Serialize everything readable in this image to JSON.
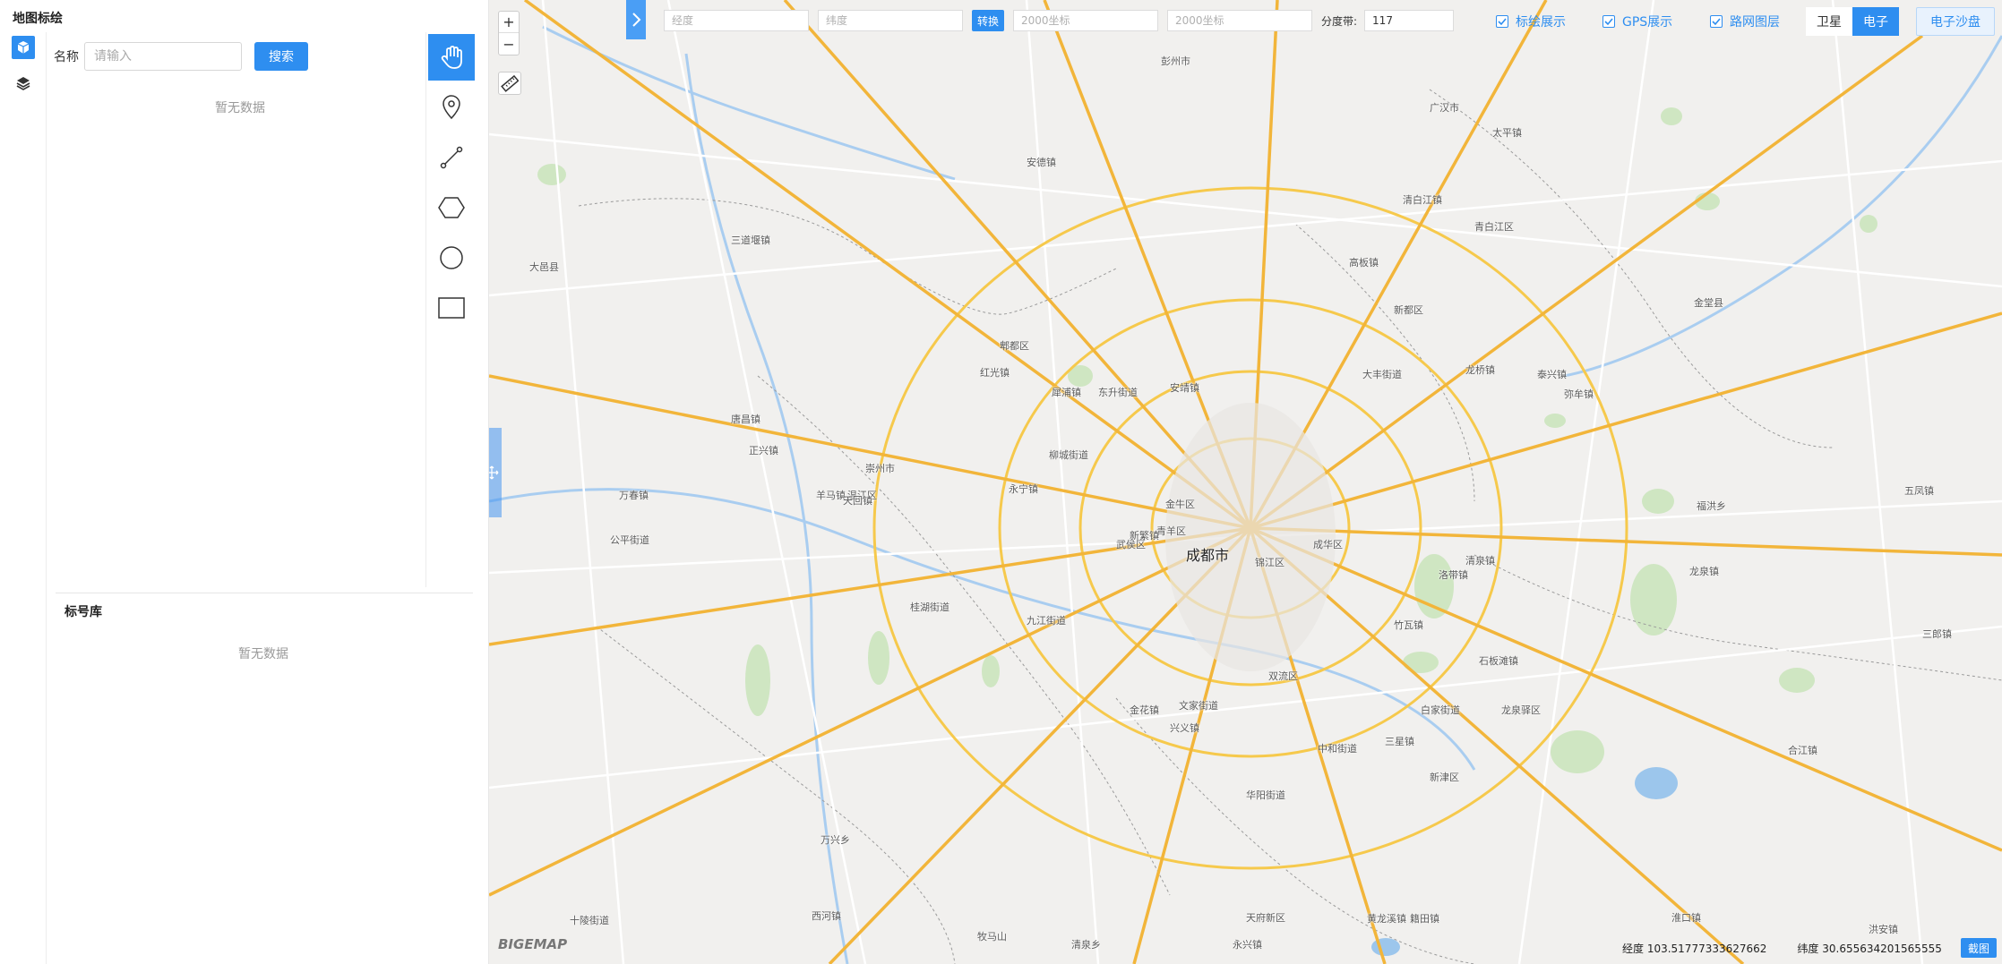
{
  "panel": {
    "title": "地图标绘",
    "search_label": "名称",
    "search_placeholder": "请输入",
    "search_button": "搜索",
    "empty_drawings": "暂无数据",
    "symbol_library_title": "标号库",
    "empty_symbols": "暂无数据"
  },
  "rail_icons": [
    "cube-icon",
    "layers-icon"
  ],
  "tools": [
    "hand-icon",
    "marker-icon",
    "polyline-icon",
    "polygon-icon",
    "circle-icon",
    "rectangle-icon"
  ],
  "toolbar": {
    "longitude_placeholder": "经度",
    "latitude_placeholder": "纬度",
    "convert_label": "转换",
    "x2000_placeholder": "2000坐标",
    "y2000_placeholder": "2000坐标",
    "zone_label": "分度带:",
    "zone_value": "117"
  },
  "layers": {
    "marker_display": "标绘展示",
    "gps_display": "GPS展示",
    "road_layer": "路网图层"
  },
  "basemap": {
    "satellite": "卫星",
    "electronic": "电子",
    "selected": "电子",
    "sandbox": "电子沙盘"
  },
  "zoom": {
    "in": "+",
    "out": "−"
  },
  "map": {
    "city": "成都市",
    "logo": "BIGEMAP",
    "longitude_readout": "经度 103.51777333627662",
    "latitude_readout": "纬度 30.655634201565555",
    "screenshot_button": "截图",
    "place_names": [
      "新都区",
      "郫都区",
      "温江区",
      "双流区",
      "龙泉驿区",
      "青白江区",
      "金牛区",
      "武侯区",
      "锦江区",
      "成华区",
      "青羊区",
      "彭州市",
      "广汉市",
      "崇州市",
      "大邑县",
      "新津区",
      "金堂县",
      "天府新区",
      "华阳街道",
      "红光镇",
      "犀浦镇",
      "安德镇",
      "唐昌镇",
      "三道堰镇",
      "竹瓦镇",
      "三星镇",
      "清泉镇",
      "石板滩镇",
      "洛带镇",
      "龙泉镇",
      "十陵街道",
      "西河镇",
      "万兴乡",
      "黄龙溪镇",
      "永兴镇",
      "籍田镇",
      "正兴镇",
      "兴义镇",
      "羊马镇",
      "万春镇",
      "公平街道",
      "柳城街道",
      "永宁镇",
      "九江街道",
      "东升街道",
      "安靖镇",
      "大丰街道",
      "天回镇",
      "桂湖街道",
      "文家街道",
      "金花镇",
      "中和街道",
      "牧马山",
      "白家街道",
      "合江镇",
      "三郎镇",
      "福洪乡",
      "五凤镇",
      "洪安镇",
      "淮口镇",
      "清泉乡",
      "高板镇",
      "太平镇",
      "新繁镇",
      "龙桥镇",
      "弥牟镇",
      "泰兴镇",
      "清白江镇"
    ]
  }
}
